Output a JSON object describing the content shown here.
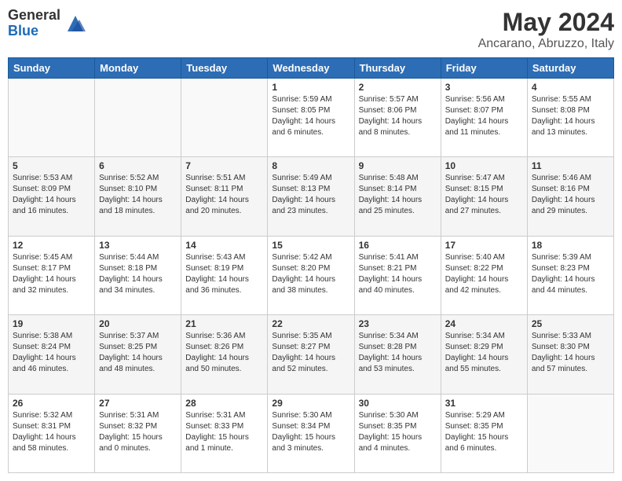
{
  "logo": {
    "general": "General",
    "blue": "Blue"
  },
  "title": "May 2024",
  "subtitle": "Ancarano, Abruzzo, Italy",
  "weekdays": [
    "Sunday",
    "Monday",
    "Tuesday",
    "Wednesday",
    "Thursday",
    "Friday",
    "Saturday"
  ],
  "weeks": [
    [
      {
        "day": "",
        "info": ""
      },
      {
        "day": "",
        "info": ""
      },
      {
        "day": "",
        "info": ""
      },
      {
        "day": "1",
        "info": "Sunrise: 5:59 AM\nSunset: 8:05 PM\nDaylight: 14 hours\nand 6 minutes."
      },
      {
        "day": "2",
        "info": "Sunrise: 5:57 AM\nSunset: 8:06 PM\nDaylight: 14 hours\nand 8 minutes."
      },
      {
        "day": "3",
        "info": "Sunrise: 5:56 AM\nSunset: 8:07 PM\nDaylight: 14 hours\nand 11 minutes."
      },
      {
        "day": "4",
        "info": "Sunrise: 5:55 AM\nSunset: 8:08 PM\nDaylight: 14 hours\nand 13 minutes."
      }
    ],
    [
      {
        "day": "5",
        "info": "Sunrise: 5:53 AM\nSunset: 8:09 PM\nDaylight: 14 hours\nand 16 minutes."
      },
      {
        "day": "6",
        "info": "Sunrise: 5:52 AM\nSunset: 8:10 PM\nDaylight: 14 hours\nand 18 minutes."
      },
      {
        "day": "7",
        "info": "Sunrise: 5:51 AM\nSunset: 8:11 PM\nDaylight: 14 hours\nand 20 minutes."
      },
      {
        "day": "8",
        "info": "Sunrise: 5:49 AM\nSunset: 8:13 PM\nDaylight: 14 hours\nand 23 minutes."
      },
      {
        "day": "9",
        "info": "Sunrise: 5:48 AM\nSunset: 8:14 PM\nDaylight: 14 hours\nand 25 minutes."
      },
      {
        "day": "10",
        "info": "Sunrise: 5:47 AM\nSunset: 8:15 PM\nDaylight: 14 hours\nand 27 minutes."
      },
      {
        "day": "11",
        "info": "Sunrise: 5:46 AM\nSunset: 8:16 PM\nDaylight: 14 hours\nand 29 minutes."
      }
    ],
    [
      {
        "day": "12",
        "info": "Sunrise: 5:45 AM\nSunset: 8:17 PM\nDaylight: 14 hours\nand 32 minutes."
      },
      {
        "day": "13",
        "info": "Sunrise: 5:44 AM\nSunset: 8:18 PM\nDaylight: 14 hours\nand 34 minutes."
      },
      {
        "day": "14",
        "info": "Sunrise: 5:43 AM\nSunset: 8:19 PM\nDaylight: 14 hours\nand 36 minutes."
      },
      {
        "day": "15",
        "info": "Sunrise: 5:42 AM\nSunset: 8:20 PM\nDaylight: 14 hours\nand 38 minutes."
      },
      {
        "day": "16",
        "info": "Sunrise: 5:41 AM\nSunset: 8:21 PM\nDaylight: 14 hours\nand 40 minutes."
      },
      {
        "day": "17",
        "info": "Sunrise: 5:40 AM\nSunset: 8:22 PM\nDaylight: 14 hours\nand 42 minutes."
      },
      {
        "day": "18",
        "info": "Sunrise: 5:39 AM\nSunset: 8:23 PM\nDaylight: 14 hours\nand 44 minutes."
      }
    ],
    [
      {
        "day": "19",
        "info": "Sunrise: 5:38 AM\nSunset: 8:24 PM\nDaylight: 14 hours\nand 46 minutes."
      },
      {
        "day": "20",
        "info": "Sunrise: 5:37 AM\nSunset: 8:25 PM\nDaylight: 14 hours\nand 48 minutes."
      },
      {
        "day": "21",
        "info": "Sunrise: 5:36 AM\nSunset: 8:26 PM\nDaylight: 14 hours\nand 50 minutes."
      },
      {
        "day": "22",
        "info": "Sunrise: 5:35 AM\nSunset: 8:27 PM\nDaylight: 14 hours\nand 52 minutes."
      },
      {
        "day": "23",
        "info": "Sunrise: 5:34 AM\nSunset: 8:28 PM\nDaylight: 14 hours\nand 53 minutes."
      },
      {
        "day": "24",
        "info": "Sunrise: 5:34 AM\nSunset: 8:29 PM\nDaylight: 14 hours\nand 55 minutes."
      },
      {
        "day": "25",
        "info": "Sunrise: 5:33 AM\nSunset: 8:30 PM\nDaylight: 14 hours\nand 57 minutes."
      }
    ],
    [
      {
        "day": "26",
        "info": "Sunrise: 5:32 AM\nSunset: 8:31 PM\nDaylight: 14 hours\nand 58 minutes."
      },
      {
        "day": "27",
        "info": "Sunrise: 5:31 AM\nSunset: 8:32 PM\nDaylight: 15 hours\nand 0 minutes."
      },
      {
        "day": "28",
        "info": "Sunrise: 5:31 AM\nSunset: 8:33 PM\nDaylight: 15 hours\nand 1 minute."
      },
      {
        "day": "29",
        "info": "Sunrise: 5:30 AM\nSunset: 8:34 PM\nDaylight: 15 hours\nand 3 minutes."
      },
      {
        "day": "30",
        "info": "Sunrise: 5:30 AM\nSunset: 8:35 PM\nDaylight: 15 hours\nand 4 minutes."
      },
      {
        "day": "31",
        "info": "Sunrise: 5:29 AM\nSunset: 8:35 PM\nDaylight: 15 hours\nand 6 minutes."
      },
      {
        "day": "",
        "info": ""
      }
    ]
  ]
}
